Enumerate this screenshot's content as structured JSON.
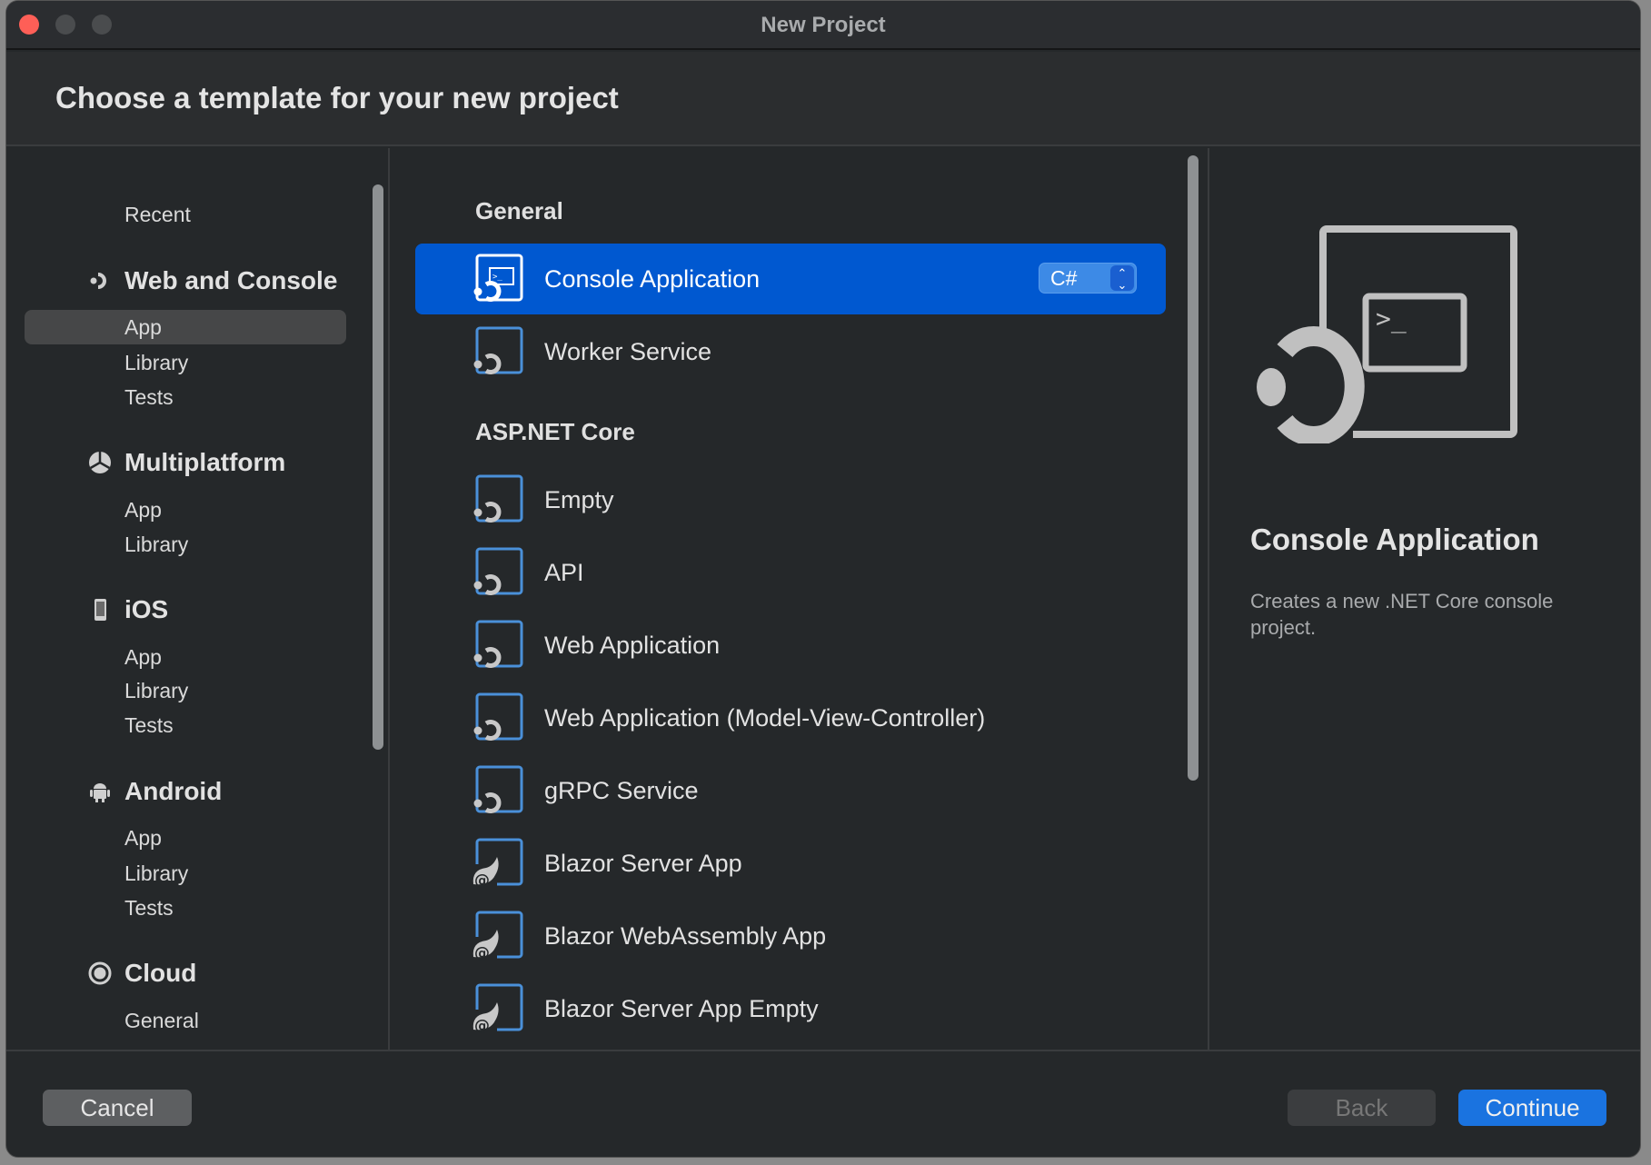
{
  "window": {
    "title": "New Project"
  },
  "header": {
    "title": "Choose a template for your new project"
  },
  "sidebar": {
    "recent": "Recent",
    "categories": [
      {
        "label": "Web and Console",
        "icon": "dotnet-icon",
        "items": [
          "App",
          "Library",
          "Tests"
        ],
        "selected": "App"
      },
      {
        "label": "Multiplatform",
        "icon": "multiplatform-icon",
        "items": [
          "App",
          "Library"
        ]
      },
      {
        "label": "iOS",
        "icon": "phone-icon",
        "items": [
          "App",
          "Library",
          "Tests"
        ]
      },
      {
        "label": "Android",
        "icon": "android-icon",
        "items": [
          "App",
          "Library",
          "Tests"
        ]
      },
      {
        "label": "Cloud",
        "icon": "cloud-icon",
        "items": [
          "General"
        ]
      }
    ]
  },
  "templates": {
    "groups": [
      {
        "label": "General",
        "items": [
          {
            "label": "Console Application",
            "selected": true,
            "language": "C#"
          },
          {
            "label": "Worker Service"
          }
        ]
      },
      {
        "label": "ASP.NET Core",
        "items": [
          {
            "label": "Empty"
          },
          {
            "label": "API"
          },
          {
            "label": "Web Application"
          },
          {
            "label": "Web Application (Model-View-Controller)"
          },
          {
            "label": "gRPC Service"
          },
          {
            "label": "Blazor Server App"
          },
          {
            "label": "Blazor WebAssembly App"
          },
          {
            "label": "Blazor Server App Empty"
          }
        ]
      }
    ]
  },
  "detail": {
    "title": "Console Application",
    "description": "Creates a new .NET Core console project."
  },
  "footer": {
    "cancel": "Cancel",
    "back": "Back",
    "continue": "Continue"
  },
  "colors": {
    "accent": "#0058d0",
    "continue": "#1a73e0",
    "close": "#fe5f57",
    "icon_blue": "#4a90d9"
  }
}
